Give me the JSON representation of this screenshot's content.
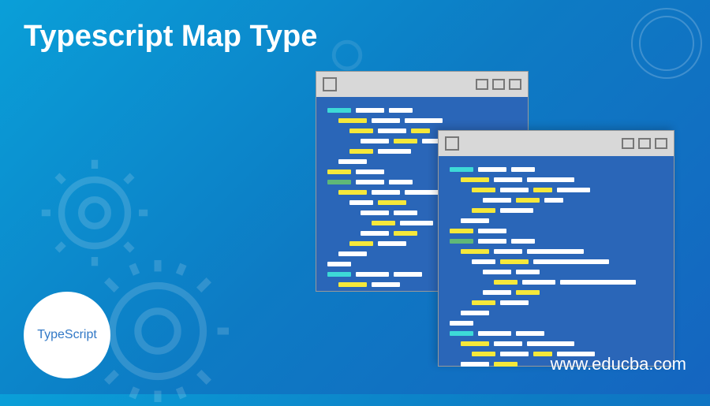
{
  "title": "Typescript Map Type",
  "website": "www.educba.com",
  "logo": {
    "text": "TypeScript"
  }
}
